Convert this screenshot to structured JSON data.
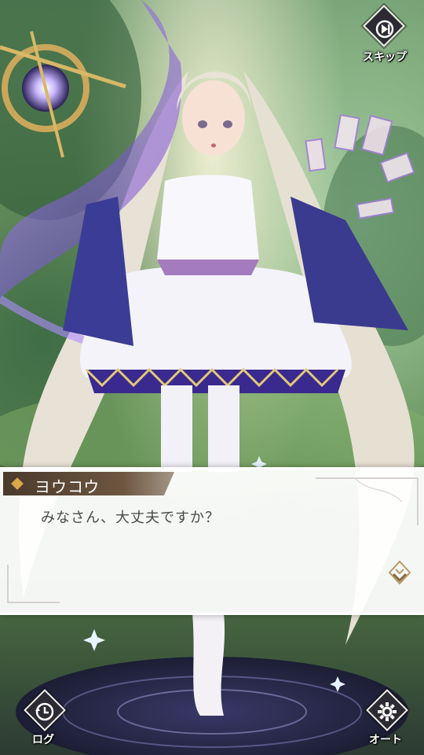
{
  "skip": {
    "label": "スキップ",
    "icon": "skip-forward-icon"
  },
  "dialogue": {
    "speaker": "ヨウコウ",
    "text": "みなさん、大丈夫ですか？",
    "advance_icon": "advance-chevron-icon"
  },
  "controls": {
    "log": {
      "label": "ログ",
      "icon": "log-history-icon"
    },
    "auto": {
      "label": "オート",
      "icon": "gear-icon"
    }
  },
  "colors": {
    "accent": "#6a3fc2",
    "name_plate": "#5a4632",
    "dialogue_text": "#4a4a4a"
  }
}
